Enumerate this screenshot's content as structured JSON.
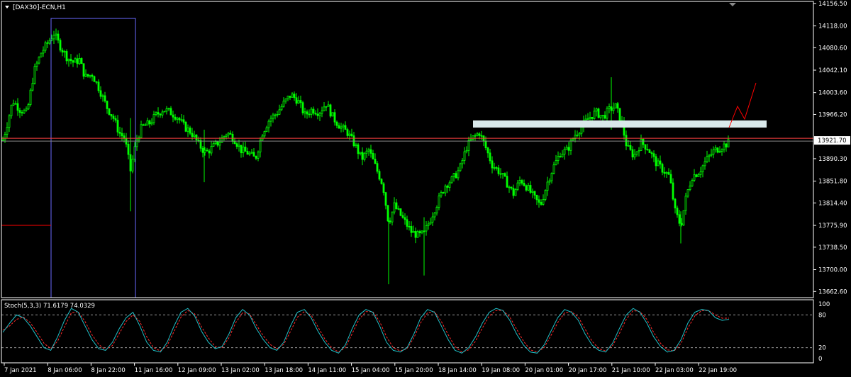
{
  "window": {
    "title": "[DAX30]-ECN,H1",
    "menu_icon": "triangle-down-icon"
  },
  "colors": {
    "background": "#000000",
    "candle": "#00ff00",
    "axis": "#ffffff",
    "box": "#6a6aff",
    "line_red": "#ff0000",
    "zone": "#d9e8ea",
    "stoch_main": "#20c0c8",
    "stoch_signal": "#ff2a2a"
  },
  "chart_data": [
    {
      "type": "candlestick",
      "title": "[DAX30]-ECN,H1",
      "ylim": [
        13652.0,
        14160.0
      ],
      "y_ticks": [
        "14156.50",
        "14118.00",
        "14080.60",
        "14042.10",
        "14003.60",
        "13966.20",
        "13890.30",
        "13851.80",
        "13814.40",
        "13775.90",
        "13738.50",
        "13700.00",
        "13662.60"
      ],
      "current_price": "13921.70",
      "x_ticks": [
        "7 Jan 2021",
        "8 Jan 06:00",
        "8 Jan 22:00",
        "11 Jan 16:00",
        "12 Jan 09:00",
        "13 Jan 02:00",
        "13 Jan 18:00",
        "14 Jan 11:00",
        "15 Jan 04:00",
        "15 Jan 20:00",
        "18 Jan 14:00",
        "19 Jan 08:00",
        "20 Jan 01:00",
        "20 Jan 17:00",
        "21 Jan 10:00",
        "22 Jan 03:00",
        "22 Jan 19:00"
      ],
      "close_path": [
        [
          0,
          13905
        ],
        [
          8,
          13940
        ],
        [
          18,
          13990
        ],
        [
          28,
          13975
        ],
        [
          38,
          13968
        ],
        [
          48,
          14040
        ],
        [
          58,
          14072
        ],
        [
          68,
          14090
        ],
        [
          76,
          14105
        ],
        [
          84,
          14085
        ],
        [
          94,
          14065
        ],
        [
          104,
          14055
        ],
        [
          112,
          14060
        ],
        [
          120,
          14030
        ],
        [
          130,
          14035
        ],
        [
          140,
          14010
        ],
        [
          150,
          13980
        ],
        [
          160,
          13960
        ],
        [
          168,
          13935
        ],
        [
          176,
          13925
        ],
        [
          184,
          13870
        ],
        [
          192,
          13920
        ],
        [
          200,
          13945
        ],
        [
          210,
          13950
        ],
        [
          220,
          13965
        ],
        [
          230,
          13975
        ],
        [
          240,
          13970
        ],
        [
          250,
          13962
        ],
        [
          260,
          13945
        ],
        [
          270,
          13935
        ],
        [
          280,
          13915
        ],
        [
          290,
          13900
        ],
        [
          300,
          13910
        ],
        [
          310,
          13920
        ],
        [
          320,
          13935
        ],
        [
          330,
          13925
        ],
        [
          340,
          13905
        ],
        [
          350,
          13900
        ],
        [
          360,
          13890
        ],
        [
          370,
          13935
        ],
        [
          380,
          13958
        ],
        [
          390,
          13968
        ],
        [
          400,
          13985
        ],
        [
          410,
          14000
        ],
        [
          420,
          13990
        ],
        [
          430,
          13965
        ],
        [
          440,
          13975
        ],
        [
          450,
          13970
        ],
        [
          460,
          13985
        ],
        [
          470,
          13960
        ],
        [
          480,
          13945
        ],
        [
          490,
          13935
        ],
        [
          500,
          13915
        ],
        [
          510,
          13890
        ],
        [
          520,
          13905
        ],
        [
          530,
          13875
        ],
        [
          540,
          13845
        ],
        [
          548,
          13780
        ],
        [
          556,
          13810
        ],
        [
          564,
          13795
        ],
        [
          572,
          13780
        ],
        [
          580,
          13765
        ],
        [
          590,
          13758
        ],
        [
          598,
          13762
        ],
        [
          608,
          13790
        ],
        [
          618,
          13818
        ],
        [
          628,
          13845
        ],
        [
          638,
          13855
        ],
        [
          648,
          13872
        ],
        [
          658,
          13910
        ],
        [
          666,
          13925
        ],
        [
          676,
          13935
        ],
        [
          684,
          13912
        ],
        [
          694,
          13880
        ],
        [
          704,
          13868
        ],
        [
          714,
          13850
        ],
        [
          724,
          13830
        ],
        [
          734,
          13855
        ],
        [
          744,
          13840
        ],
        [
          754,
          13822
        ],
        [
          762,
          13810
        ],
        [
          772,
          13850
        ],
        [
          780,
          13875
        ],
        [
          790,
          13900
        ],
        [
          800,
          13905
        ],
        [
          810,
          13930
        ],
        [
          820,
          13945
        ],
        [
          830,
          13960
        ],
        [
          840,
          13970
        ],
        [
          850,
          13962
        ],
        [
          860,
          13975
        ],
        [
          868,
          13980
        ],
        [
          876,
          13955
        ],
        [
          884,
          13910
        ],
        [
          894,
          13895
        ],
        [
          904,
          13918
        ],
        [
          914,
          13908
        ],
        [
          924,
          13885
        ],
        [
          934,
          13872
        ],
        [
          944,
          13860
        ],
        [
          952,
          13800
        ],
        [
          960,
          13775
        ],
        [
          968,
          13828
        ],
        [
          976,
          13860
        ],
        [
          986,
          13868
        ],
        [
          996,
          13888
        ],
        [
          1006,
          13903
        ],
        [
          1016,
          13910
        ],
        [
          1028,
          13918
        ]
      ]
    },
    {
      "type": "line",
      "title": "Stoch(5,3,3) 71.6179 74.0329",
      "ylim": [
        0,
        100
      ],
      "y_ticks": [
        "100",
        "80",
        "20",
        "0"
      ],
      "series": [
        {
          "values": [
            48,
            65,
            80,
            75,
            60,
            40,
            20,
            15,
            40,
            70,
            92,
            85,
            60,
            35,
            18,
            15,
            30,
            55,
            75,
            85,
            60,
            30,
            15,
            12,
            30,
            60,
            85,
            92,
            78,
            50,
            30,
            18,
            22,
            45,
            75,
            90,
            80,
            55,
            35,
            20,
            15,
            30,
            60,
            85,
            90,
            75,
            50,
            30,
            15,
            10,
            25,
            55,
            80,
            90,
            85,
            60,
            30,
            15,
            12,
            20,
            45,
            75,
            90,
            85,
            60,
            35,
            15,
            10,
            20,
            40,
            65,
            85,
            92,
            88,
            70,
            45,
            25,
            12,
            10,
            25,
            50,
            75,
            90,
            85,
            70,
            45,
            25,
            15,
            12,
            28,
            55,
            80,
            92,
            85,
            65,
            40,
            22,
            12,
            15,
            35,
            65,
            85,
            90,
            88,
            75,
            70,
            72
          ]
        },
        {
          "values": [
            52,
            60,
            72,
            76,
            66,
            48,
            28,
            18,
            32,
            58,
            84,
            86,
            68,
            44,
            26,
            16,
            24,
            46,
            68,
            80,
            68,
            40,
            20,
            14,
            24,
            50,
            76,
            88,
            82,
            58,
            38,
            22,
            20,
            38,
            66,
            84,
            82,
            62,
            42,
            26,
            18,
            26,
            50,
            76,
            86,
            80,
            58,
            36,
            20,
            12,
            20,
            46,
            72,
            86,
            86,
            68,
            40,
            20,
            14,
            18,
            38,
            66,
            84,
            86,
            68,
            44,
            22,
            12,
            16,
            32,
            56,
            78,
            88,
            88,
            76,
            54,
            32,
            16,
            12,
            20,
            42,
            66,
            84,
            86,
            76,
            54,
            32,
            18,
            14,
            24,
            46,
            72,
            88,
            86,
            72,
            48,
            28,
            16,
            14,
            28,
            56,
            78,
            88,
            88,
            80,
            74,
            74
          ]
        }
      ]
    }
  ]
}
